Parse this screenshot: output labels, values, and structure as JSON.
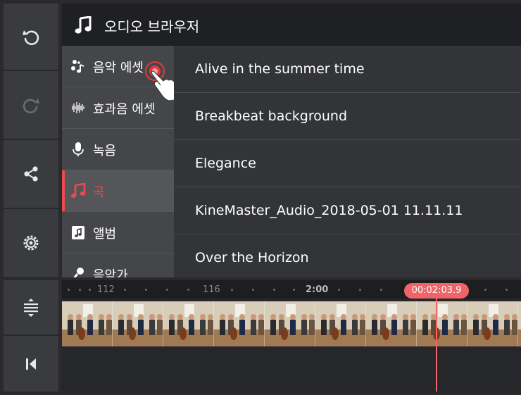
{
  "header": {
    "title": "오디오 브라우저"
  },
  "categories": [
    {
      "label": "음악 에셋",
      "icon": "music-asset-icon"
    },
    {
      "label": "효과음 에셋",
      "icon": "waveform-icon"
    },
    {
      "label": "녹음",
      "icon": "microphone-icon"
    },
    {
      "label": "곡",
      "icon": "music-note-icon",
      "active": true
    },
    {
      "label": "앨범",
      "icon": "album-icon"
    },
    {
      "label": "음악가",
      "icon": "artist-icon"
    }
  ],
  "songs": [
    "Alive in the summer time",
    "Breakbeat background",
    "Elegance",
    "KineMaster_Audio_2018-05-01 11.11.11",
    "Over the Horizon"
  ],
  "timeline": {
    "ticks": [
      "112",
      "116",
      "2:00"
    ],
    "playhead_time": "00:02:03.9"
  },
  "colors": {
    "accent": "#ee4a4e",
    "playhead": "#f06468"
  }
}
